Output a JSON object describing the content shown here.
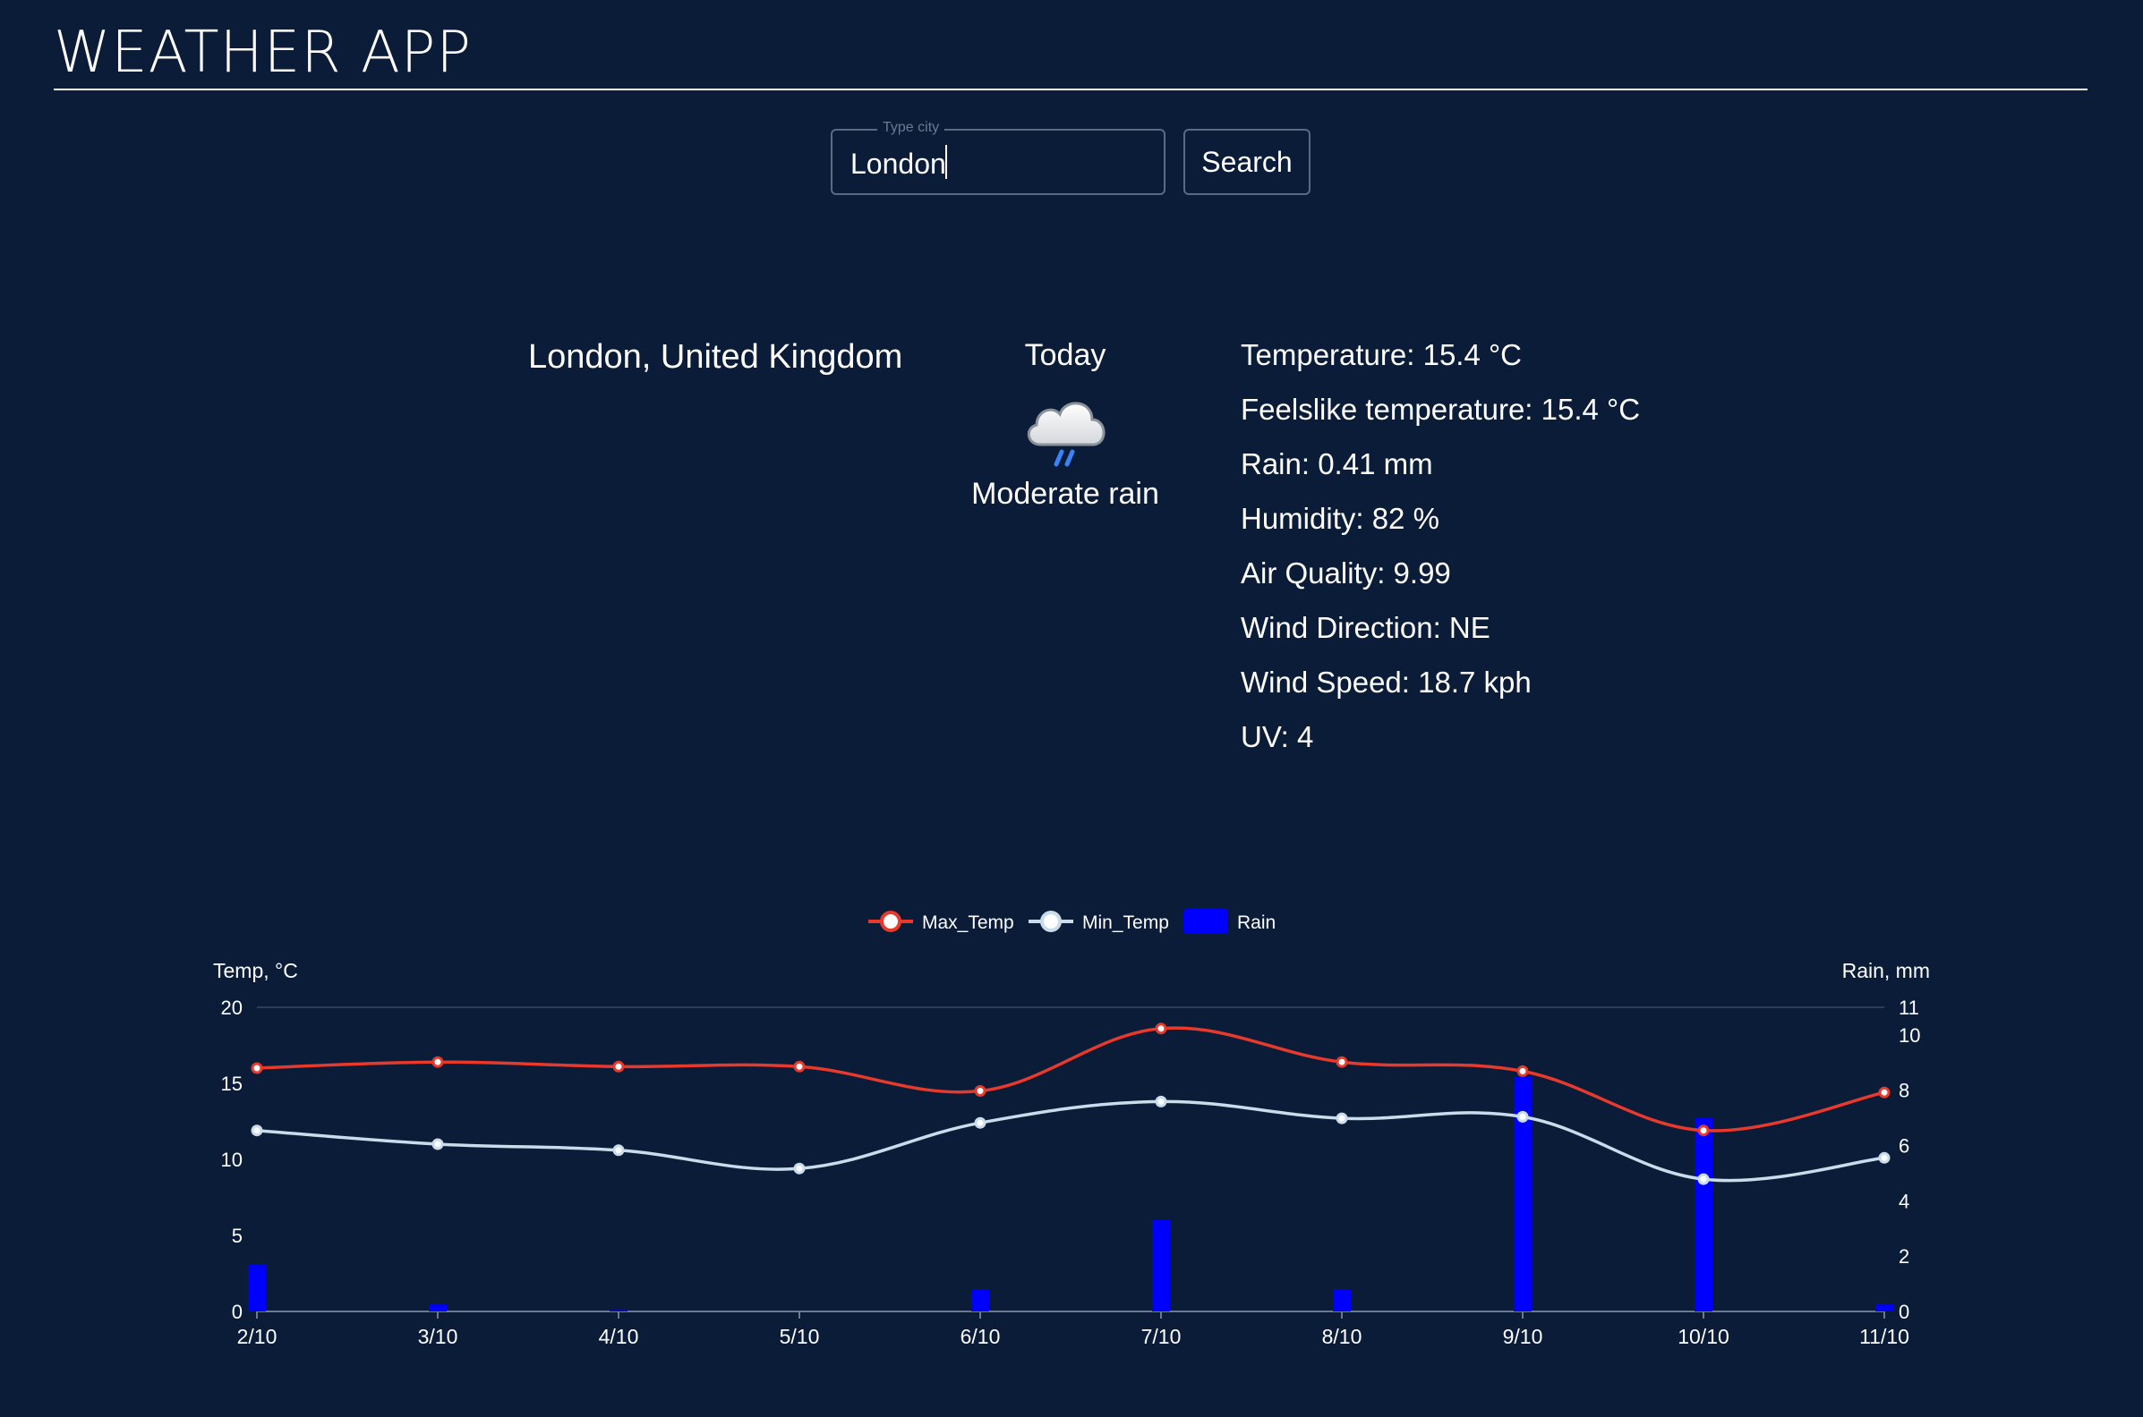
{
  "header": {
    "title": "WEATHER APP"
  },
  "search": {
    "legend": "Type city",
    "value": "London",
    "button_label": "Search"
  },
  "location": "London, United Kingdom",
  "today": {
    "label": "Today",
    "condition": "Moderate rain",
    "icon": "rain-cloud-icon"
  },
  "stats": [
    "Temperature: 15.4 °C",
    "Feelslike temperature: 15.4 °C",
    "Rain: 0.41 mm",
    "Humidity: 82 %",
    "Air Quality: 9.99",
    "Wind Direction: NE",
    "Wind Speed: 18.7 kph",
    "UV: 4"
  ],
  "colors": {
    "background": "#0a1c38",
    "max_temp": "#e8392d",
    "min_temp": "#c8dcea",
    "rain": "#0000ff"
  },
  "chart_data": {
    "type": "line",
    "categories": [
      "2/10",
      "3/10",
      "4/10",
      "5/10",
      "6/10",
      "7/10",
      "8/10",
      "9/10",
      "10/10",
      "11/10"
    ],
    "series": [
      {
        "name": "Max_Temp",
        "type": "line",
        "axis": "left",
        "values": [
          16.0,
          16.4,
          16.1,
          16.1,
          14.5,
          18.6,
          16.4,
          15.8,
          11.9,
          14.4
        ]
      },
      {
        "name": "Min_Temp",
        "type": "line",
        "axis": "left",
        "values": [
          11.9,
          11.0,
          10.6,
          9.4,
          12.4,
          13.8,
          12.7,
          12.8,
          8.7,
          10.1
        ]
      },
      {
        "name": "Rain",
        "type": "bar",
        "axis": "right",
        "values": [
          1.7,
          0.25,
          0.05,
          0.0,
          0.8,
          3.3,
          0.8,
          8.5,
          7.0,
          0.25
        ]
      }
    ],
    "ylabel": "Temp, °C",
    "ylabel_right": "Rain, mm",
    "ylim": [
      0,
      20
    ],
    "yticks": [
      0,
      5,
      10,
      15,
      20
    ],
    "ylim_right": [
      0,
      11
    ],
    "yticks_right": [
      0,
      2,
      4,
      6,
      8,
      10,
      11
    ],
    "legend": "top-center",
    "grid": false
  }
}
